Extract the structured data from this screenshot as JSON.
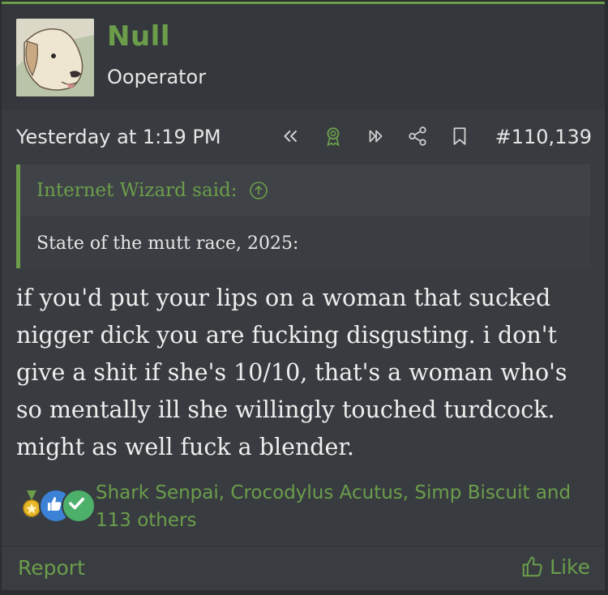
{
  "user": {
    "name": "Null",
    "title": "Ooperator"
  },
  "meta": {
    "timestamp": "Yesterday at 1:19 PM",
    "post_number": "#110,139"
  },
  "meta_icons": [
    "double-chevron-left-icon",
    "award-ribbon-icon",
    "double-chevron-right-icon",
    "share-icon",
    "bookmark-icon"
  ],
  "quote": {
    "author_label": "Internet Wizard said:",
    "text": "State of the mutt race, 2025:"
  },
  "message": {
    "text": "if you'd put your lips on a woman that sucked nigger dick you are fucking disgusting. i don't give a shit if she's 10/10, that's a woman who's so mentally ill she willingly touched turdcock. might as well fuck a blender."
  },
  "reactions": {
    "icons": [
      "medal-icon",
      "thumbs-up-icon",
      "checkmark-icon"
    ],
    "text": "Shark Senpai, Crocodylus Acutus, Simp Biscuit and 113 others"
  },
  "footer": {
    "report_label": "Report",
    "like_label": "Like"
  },
  "colors": {
    "accent": "#6b9d4b",
    "background": "#383c40",
    "page": "#2b2e31"
  }
}
